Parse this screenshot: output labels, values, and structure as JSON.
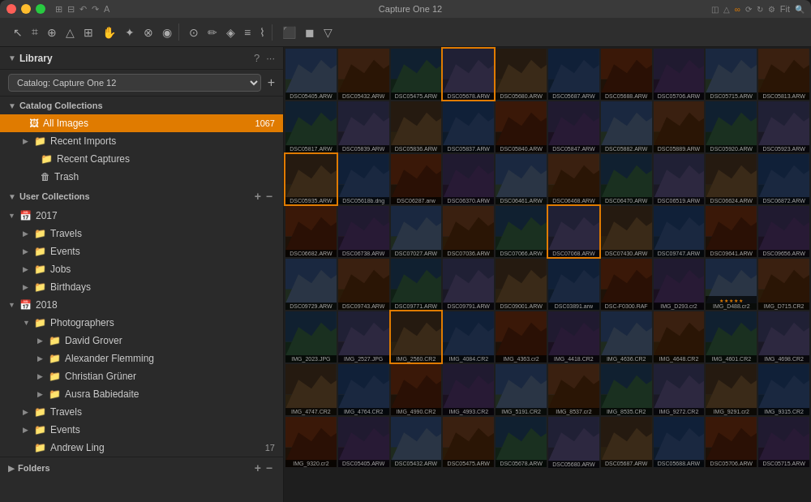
{
  "window": {
    "title": "Capture One 12"
  },
  "titlebar": {
    "title": "Capture One 12"
  },
  "sidebar": {
    "library_label": "Library",
    "catalog_label": "Catalog: Capture One 12",
    "help_icon": "?",
    "more_icon": "···",
    "sections": {
      "catalog_collections": {
        "label": "Catalog Collections",
        "expanded": true
      },
      "user_collections": {
        "label": "User Collections",
        "expanded": true
      },
      "folders": {
        "label": "Folders",
        "expanded": false
      }
    },
    "catalog_items": [
      {
        "id": "all-images",
        "label": "All Images",
        "count": "1067",
        "icon": "📷",
        "indent": 0,
        "selected": true,
        "arrow": ""
      },
      {
        "id": "recent-imports",
        "label": "Recent Imports",
        "count": "",
        "icon": "📁",
        "indent": 1,
        "selected": false,
        "arrow": "▶"
      },
      {
        "id": "recent-captures",
        "label": "Recent Captures",
        "count": "",
        "icon": "📁",
        "indent": 1,
        "selected": false,
        "arrow": ""
      },
      {
        "id": "trash",
        "label": "Trash",
        "count": "",
        "icon": "🗑",
        "indent": 1,
        "selected": false,
        "arrow": ""
      }
    ],
    "user_items": [
      {
        "id": "2017",
        "label": "2017",
        "count": "",
        "icon": "📅",
        "indent": 0,
        "selected": false,
        "arrow": "▼"
      },
      {
        "id": "travels-2017",
        "label": "Travels",
        "count": "",
        "icon": "📁",
        "indent": 2,
        "selected": false,
        "arrow": "▶"
      },
      {
        "id": "events-2017",
        "label": "Events",
        "count": "",
        "icon": "📁",
        "indent": 2,
        "selected": false,
        "arrow": "▶"
      },
      {
        "id": "jobs-2017",
        "label": "Jobs",
        "count": "",
        "icon": "📁",
        "indent": 2,
        "selected": false,
        "arrow": "▶"
      },
      {
        "id": "birthdays-2017",
        "label": "Birthdays",
        "count": "",
        "icon": "📁",
        "indent": 2,
        "selected": false,
        "arrow": "▶"
      },
      {
        "id": "2018",
        "label": "2018",
        "count": "",
        "icon": "📅",
        "indent": 0,
        "selected": false,
        "arrow": "▼"
      },
      {
        "id": "photographers",
        "label": "Photographers",
        "count": "",
        "icon": "📁",
        "indent": 2,
        "selected": false,
        "arrow": "▼"
      },
      {
        "id": "david-grover",
        "label": "David Grover",
        "count": "",
        "icon": "📁",
        "indent": 4,
        "selected": false,
        "arrow": "▶"
      },
      {
        "id": "alexander-flemming",
        "label": "Alexander Flemming",
        "count": "",
        "icon": "📁",
        "indent": 4,
        "selected": false,
        "arrow": "▶"
      },
      {
        "id": "christian-gruner",
        "label": "Christian Grüner",
        "count": "",
        "icon": "📁",
        "indent": 4,
        "selected": false,
        "arrow": "▶"
      },
      {
        "id": "ausra-babiedaite",
        "label": "Ausra Babiedaite",
        "count": "",
        "icon": "📁",
        "indent": 4,
        "selected": false,
        "arrow": "▶"
      },
      {
        "id": "travels-2018",
        "label": "Travels",
        "count": "",
        "icon": "📁",
        "indent": 2,
        "selected": false,
        "arrow": "▶"
      },
      {
        "id": "events-2018",
        "label": "Events",
        "count": "",
        "icon": "📁",
        "indent": 2,
        "selected": false,
        "arrow": "▶"
      },
      {
        "id": "andrew-ling",
        "label": "Andrew Ling",
        "count": "17",
        "icon": "📁",
        "indent": 2,
        "selected": false,
        "arrow": ""
      }
    ],
    "add_button": "+",
    "remove_button": "−"
  },
  "photos": {
    "rows": [
      {
        "images": [
          {
            "label": "DSC05405.ARW",
            "color": "#2d3545"
          },
          {
            "label": "DSC05432.ARW",
            "color": "#3a3530"
          },
          {
            "label": "DSC05475.ARW",
            "color": "#1e2d3a"
          },
          {
            "label": "DSC05678.ARW",
            "color": "#3a3520"
          },
          {
            "label": "DSC05680.ARW",
            "color": "#2a3530"
          },
          {
            "label": "DSC05687.ARW",
            "color": "#253040"
          },
          {
            "label": "DSC05688.ARW",
            "color": "#203545"
          },
          {
            "label": "DSC05706.ARW",
            "color": "#2a3040"
          },
          {
            "label": "DSC05715.ARW",
            "color": "#2d3030"
          }
        ]
      },
      {
        "images": [
          {
            "label": "DSC05813.ARW",
            "color": "#302828"
          },
          {
            "label": "DSC05817.ARW",
            "color": "#283040"
          },
          {
            "label": "DSC05839.ARW",
            "color": "#2a3528"
          },
          {
            "label": "DSC05836.ARW",
            "color": "#303a35"
          },
          {
            "label": "DSC05837.ARW",
            "color": "#283540"
          },
          {
            "label": "DSC05840.ARW",
            "color": "#302830"
          },
          {
            "label": "DSC05847.ARW",
            "color": "#353028"
          },
          {
            "label": "DSC05882.ARW",
            "color": "#283535"
          },
          {
            "label": "DSC05889.ARW",
            "color": "#303530"
          }
        ]
      },
      {
        "images": [
          {
            "label": "DSC05920.ARW",
            "color": "#3a3530"
          },
          {
            "label": "DSC05923.ARW",
            "color": "#283040"
          },
          {
            "label": "DSC05935.ARW",
            "color": "#2a2d30"
          },
          {
            "label": "DSC05618b.dng",
            "color": "#353535"
          },
          {
            "label": "DSC06287.arw",
            "color": "#302828"
          },
          {
            "label": "DSC06370.ARW",
            "color": "#2a3545"
          },
          {
            "label": "DSC06461.ARW",
            "color": "#203040"
          },
          {
            "label": "DSC06468.ARW",
            "color": "#282828"
          },
          {
            "label": "DSC06470.ARW",
            "color": "#283040"
          }
        ]
      },
      {
        "images": [
          {
            "label": "DSC06519.ARW",
            "color": "#2d3a2d"
          },
          {
            "label": "DSC06624.ARW",
            "color": "#303535"
          },
          {
            "label": "DSC06872.ARW",
            "color": "#2a2a35"
          },
          {
            "label": "DSC06682.ARW",
            "color": "#353a28"
          },
          {
            "label": "DSC06738.ARW",
            "color": "#283035"
          },
          {
            "label": "DSC07027.ARW",
            "color": "#202835"
          },
          {
            "label": "DSC07036.ARW",
            "color": "#2a2a2d"
          },
          {
            "label": "DSC07066.ARW",
            "color": "#2a3030"
          },
          {
            "label": "DSC07068.ARW",
            "color": "#283535"
          }
        ]
      },
      {
        "images": [
          {
            "label": "DSC07430.ARW",
            "color": "#2a3528"
          },
          {
            "label": "DSC09747.ARW",
            "color": "#353028"
          },
          {
            "label": "DSC09641.ARW",
            "color": "#283028"
          },
          {
            "label": "DSC09656.ARW",
            "color": "#3a3530"
          },
          {
            "label": "DSC09729.ARW",
            "color": "#202830"
          },
          {
            "label": "DSC09743.ARW",
            "color": "#303535"
          },
          {
            "label": "DSC09771.ARW",
            "color": "#283040"
          },
          {
            "label": "DSC09791.ARW",
            "color": "#3a3030"
          },
          {
            "label": "DSC09001.ARW",
            "color": "#283028"
          }
        ]
      },
      {
        "images": [
          {
            "label": "DSC03891.arw",
            "color": "#2a2d35"
          },
          {
            "label": "DSC-F0300.RAF",
            "color": "#303528"
          },
          {
            "label": "IMG_D293.cr2",
            "color": "#353030"
          },
          {
            "label": "IMG_D488.cr2",
            "color": "#2d3535",
            "stars": 5
          },
          {
            "label": "IMG_D715.CR2",
            "color": "#2a3028"
          },
          {
            "label": "IMG_2023.JPG",
            "color": "#303535"
          },
          {
            "label": "IMG_2527.JPG",
            "color": "#2a2d35"
          },
          {
            "label": "IMG_2560.CR2",
            "color": "#283535"
          }
        ]
      },
      {
        "images": [
          {
            "label": "IMG_4084.CR2",
            "color": "#2a3a35"
          },
          {
            "label": "IMG_4363.cr2",
            "color": "#2d2a35"
          },
          {
            "label": "IMG_4418.CR2",
            "color": "#353530"
          },
          {
            "label": "IMG_4636.CR2",
            "color": "#2a3040"
          },
          {
            "label": "IMG_4648.CR2",
            "color": "#303a28"
          },
          {
            "label": "IMG_4601.CR2",
            "color": "#283545"
          },
          {
            "label": "IMG_4698.CR2",
            "color": "#2a2830"
          },
          {
            "label": "IMG_4747.CR2",
            "color": "#2d3535"
          },
          {
            "label": "IMG_4764.CR2",
            "color": "#303030"
          }
        ]
      },
      {
        "images": [
          {
            "label": "IMG_4990.CR2",
            "color": "#2a3028"
          },
          {
            "label": "IMG_4993.CR2",
            "color": "#353035"
          },
          {
            "label": "IMG_5191.CR2",
            "color": "#303530"
          },
          {
            "label": "IMG_8537.cr2",
            "color": "#353528"
          },
          {
            "label": "IMG_8535.CR2",
            "color": "#2a2d3a"
          },
          {
            "label": "IMG_9272.CR2",
            "color": "#283535"
          },
          {
            "label": "IMG_9291.cr2",
            "color": "#2d3040"
          },
          {
            "label": "IMG_9315.CR2",
            "color": "#2a3535"
          },
          {
            "label": "IMG_9320.cr2",
            "color": "#302828"
          }
        ]
      }
    ]
  }
}
